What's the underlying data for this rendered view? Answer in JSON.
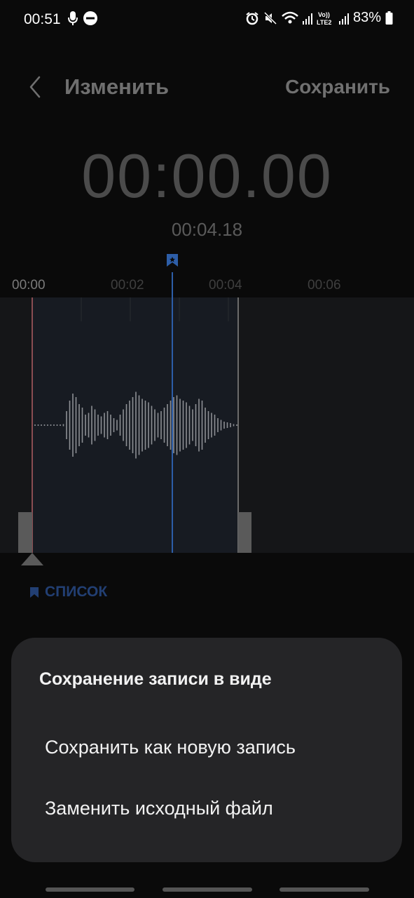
{
  "status_bar": {
    "time": "00:51",
    "battery": "83%",
    "left_icons": [
      "microphone-icon",
      "do-not-disturb-icon"
    ],
    "right_icons": [
      "alarm-icon",
      "mute-icon",
      "wifi-icon",
      "signal-icon",
      "volte-lte2-icon",
      "signal-icon",
      "battery-icon"
    ]
  },
  "header": {
    "title": "Изменить",
    "save_label": "Сохранить"
  },
  "timer": {
    "current": "00:00.00",
    "duration": "00:04.18"
  },
  "timeline": {
    "labels": [
      "00:00",
      "00:02",
      "00:04",
      "00:06"
    ]
  },
  "bookmarks": {
    "list_label": "СПИСОК"
  },
  "dialog": {
    "title": "Сохранение записи в виде",
    "options": [
      "Сохранить как новую запись",
      "Заменить исходный файл"
    ]
  },
  "colors": {
    "accent_blue": "#2d5ea8",
    "dialog_bg": "#252527"
  }
}
